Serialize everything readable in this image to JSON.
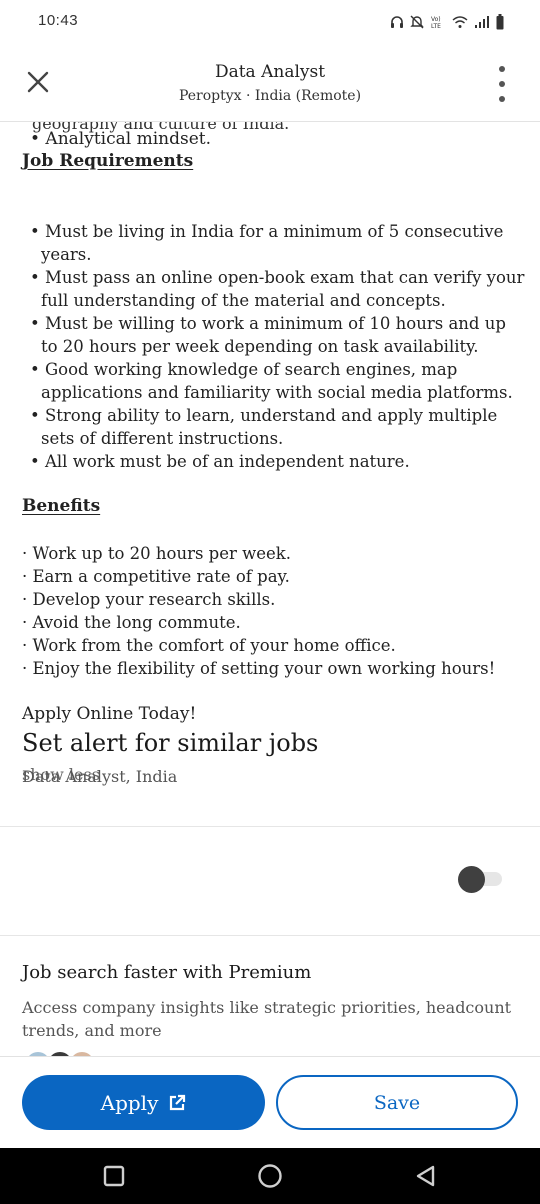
{
  "status_bar": {
    "time": "10:43",
    "icons": [
      "headphones-icon",
      "mute-icon",
      "volte-icon",
      "wifi-icon",
      "signal-icon",
      "battery-icon"
    ]
  },
  "header": {
    "title": "Data Analyst",
    "subtitle": "Peroptyx · India (Remote)"
  },
  "description": {
    "clipped_text": "geography and culture of India.",
    "analytical": "• Analytical mindset.",
    "requirements_heading": "Job Requirements",
    "requirements": [
      [
        "• Must be living in India for a minimum of 5 consecutive",
        "years."
      ],
      [
        "• Must pass an online open-book exam that can verify your",
        "full understanding of the material and concepts."
      ],
      [
        "• Must be willing to work a minimum of 10 hours and up",
        "to 20 hours per week depending on task availability."
      ],
      [
        "• Good working knowledge of search engines, map",
        "applications and familiarity with social media platforms."
      ],
      [
        "• Strong ability to learn, understand and apply multiple",
        "sets of different instructions."
      ],
      [
        "• All work must be of an independent nature."
      ]
    ],
    "benefits_heading": "Benefits",
    "benefits": [
      "· Work up to 20 hours per week.",
      "· Earn a competitive rate of pay.",
      "· Develop your research skills.",
      "· Avoid the long commute.",
      "· Work from the comfort of your home office.",
      "· Enjoy the flexibility of setting your own working hours!"
    ],
    "closing": "Apply Online Today!",
    "show_less": "show less"
  },
  "alert": {
    "title": "Set alert for similar jobs",
    "subtitle": "Data Analyst, India",
    "enabled": false
  },
  "premium": {
    "title": "Job search faster with Premium",
    "description": "Access company insights like strategic priorities, headcount trends, and more"
  },
  "actions": {
    "apply_label": "Apply",
    "save_label": "Save"
  },
  "colors": {
    "accent": "#0a66c2"
  }
}
